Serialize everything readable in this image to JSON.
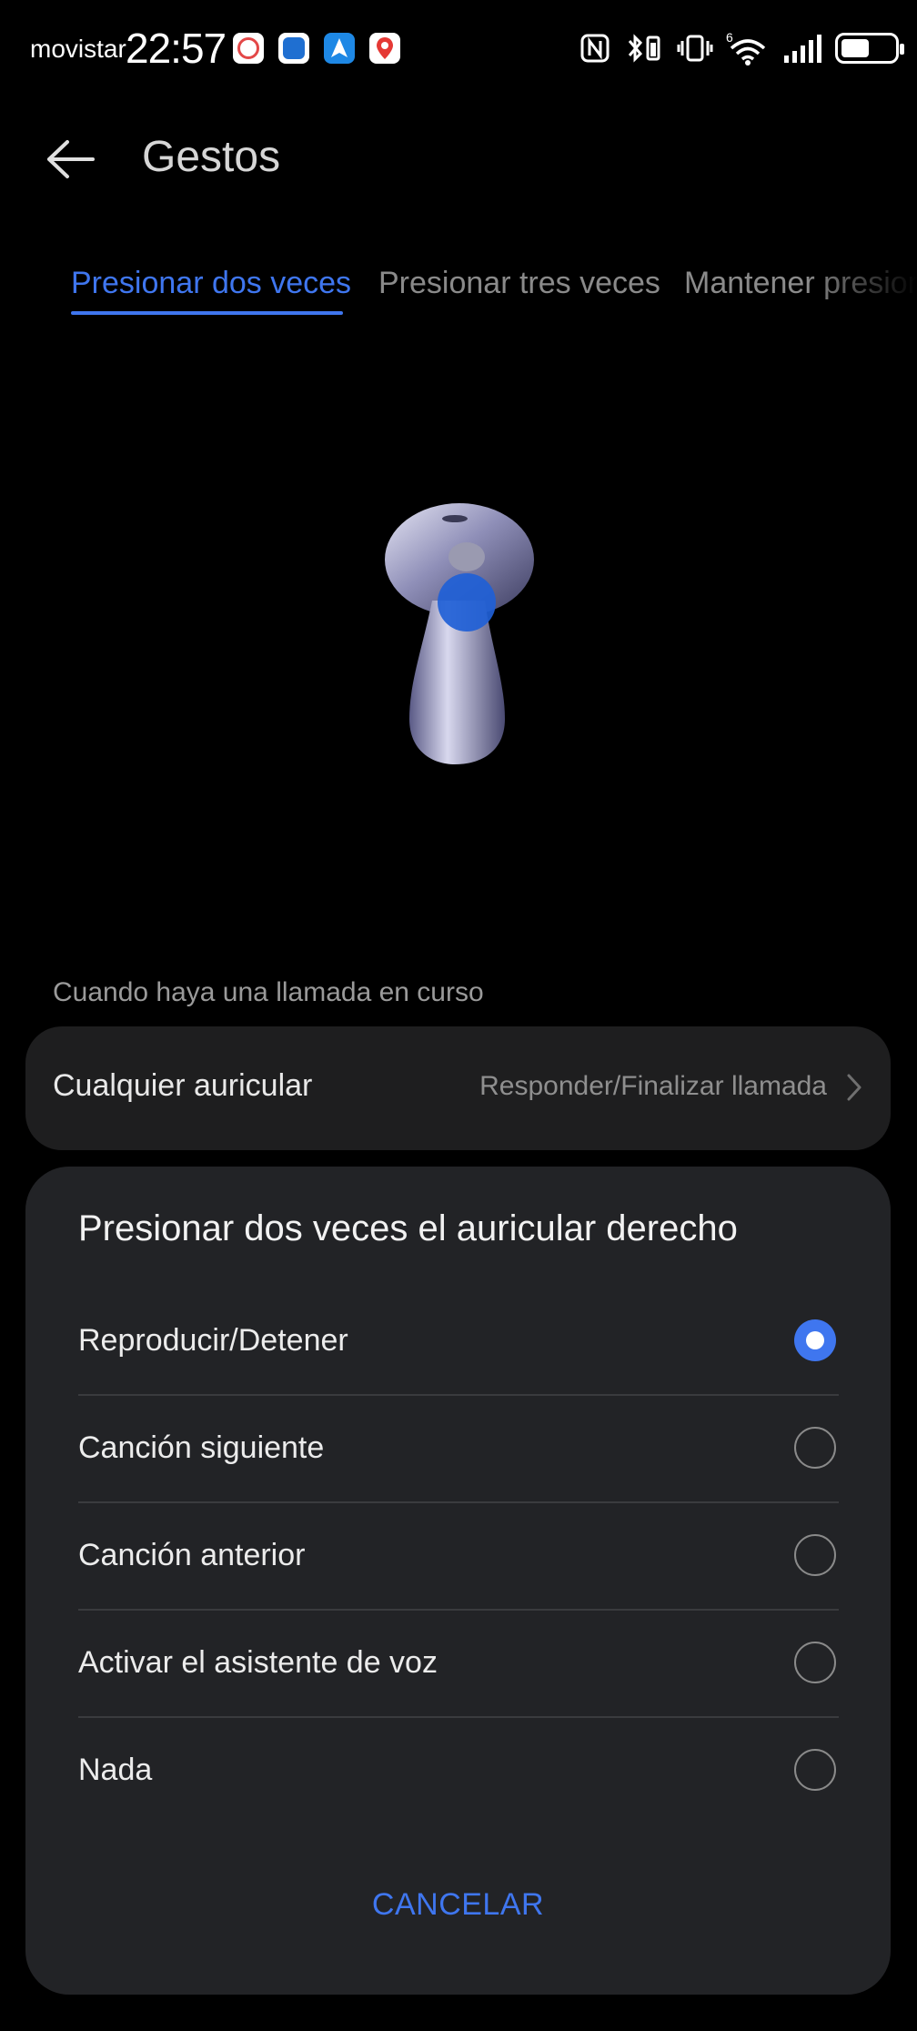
{
  "status_bar": {
    "carrier": "movistar",
    "time": "22:57",
    "network_label": "6"
  },
  "header": {
    "title": "Gestos"
  },
  "tabs": [
    {
      "label": "Presionar dos veces",
      "active": true
    },
    {
      "label": "Presionar tres veces",
      "active": false
    },
    {
      "label": "Mantener presionado",
      "active": false
    }
  ],
  "call_section": {
    "label": "Cuando haya una llamada en curso",
    "setting_label": "Cualquier auricular",
    "setting_value": "Responder/Finalizar llamada"
  },
  "sheet": {
    "title": "Presionar dos veces el auricular derecho",
    "options": [
      {
        "label": "Reproducir/Detener",
        "selected": true
      },
      {
        "label": "Canción siguiente",
        "selected": false
      },
      {
        "label": "Canción anterior",
        "selected": false
      },
      {
        "label": "Activar el asistente de voz",
        "selected": false
      },
      {
        "label": "Nada",
        "selected": false
      }
    ],
    "cancel_label": "CANCELAR"
  },
  "colors": {
    "accent": "#3f76ef",
    "background": "#000000",
    "card": "#1e1e1f",
    "sheet": "#222326"
  }
}
